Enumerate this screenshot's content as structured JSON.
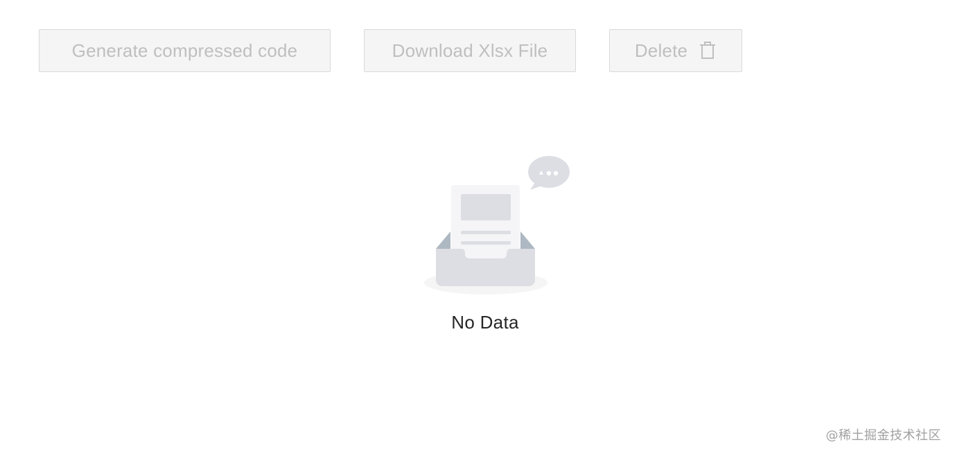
{
  "toolbar": {
    "generate_label": "Generate compressed code",
    "download_label": "Download Xlsx File",
    "delete_label": "Delete",
    "delete_icon": "trash-icon"
  },
  "empty_state": {
    "text": "No Data",
    "illustration_icon": "empty-inbox-icon"
  },
  "watermark": {
    "text": "@稀土掘金技术社区"
  },
  "colors": {
    "button_bg": "#f5f5f5",
    "button_border": "#d9d9d9",
    "button_text_disabled": "#bfbfbf",
    "empty_text": "#262626",
    "illustration_gray": "#dcdee3"
  }
}
